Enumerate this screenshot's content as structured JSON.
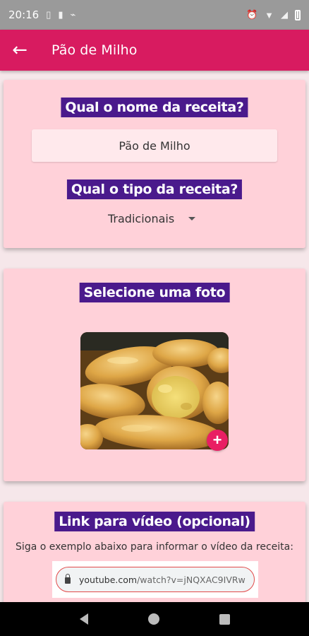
{
  "status_bar": {
    "time": "20:16",
    "icons_left": [
      "sim-icon",
      "sd-card-icon",
      "cast-icon"
    ],
    "icons_right": [
      "alarm-icon",
      "wifi-icon",
      "signal-icon",
      "battery-icon"
    ]
  },
  "app_bar": {
    "back_icon": "←",
    "title": "Pão de Milho"
  },
  "card_name": {
    "label": "Qual o nome da receita?",
    "name_value": "Pão de Milho",
    "type_label": "Qual o tipo da receita?",
    "type_value": "Tradicionais"
  },
  "card_photo": {
    "label": "Selecione uma foto",
    "add_icon": "+"
  },
  "card_video": {
    "label": "Link para vídeo (opcional)",
    "help": "Siga o exemplo abaixo para informar o vídeo da receita:",
    "url_domain": "youtube.com",
    "url_path": "/watch?v=jNQXAC9IVRw"
  },
  "colors": {
    "app_bar": "#d81b60",
    "card": "#ffd1d9",
    "label_bg": "#4a1a8c",
    "fab": "#e91e63"
  }
}
